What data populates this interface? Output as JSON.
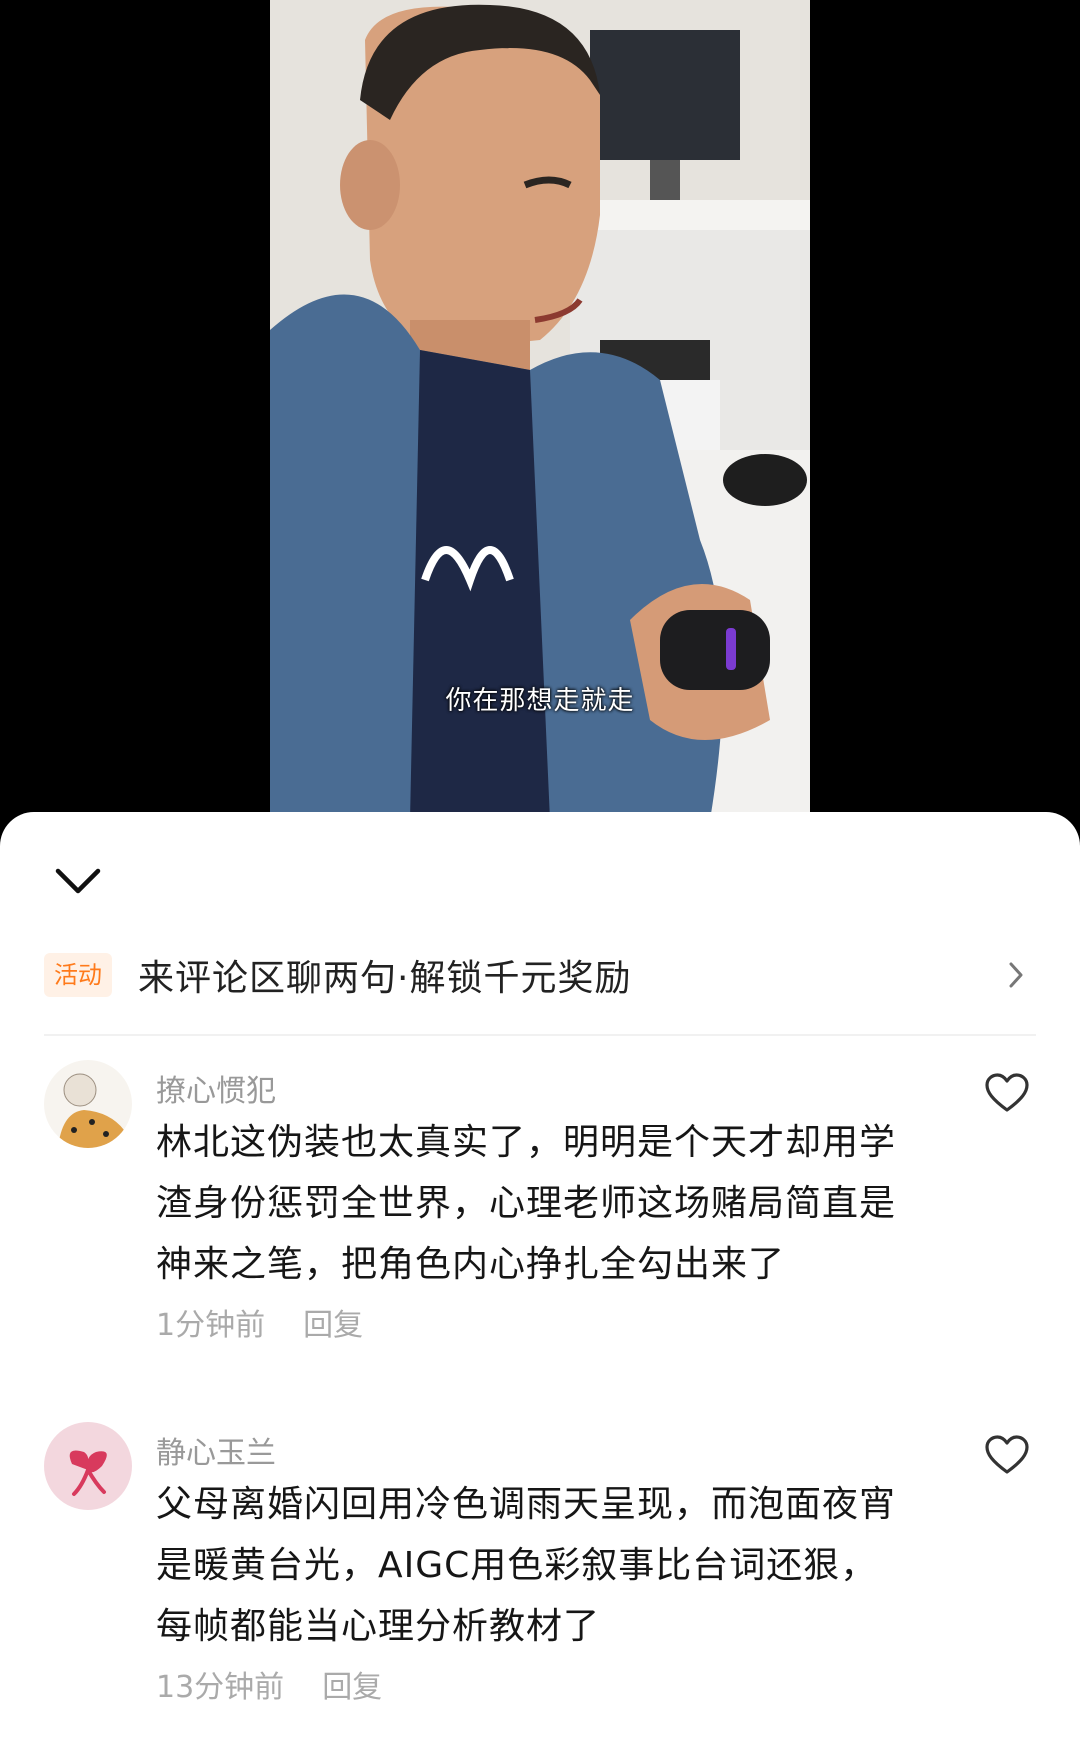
{
  "video": {
    "subtitle": "你在那想走就走"
  },
  "sheet": {
    "collapse_icon": "chevron-down-icon",
    "activity": {
      "badge": "活动",
      "text": "来评论区聊两句·解锁千元奖励",
      "icon": "chevron-right-icon"
    },
    "comments": [
      {
        "username": "撩心惯犯",
        "text": "林北这伪装也太真实了，明明是个天才却用学渣身份惩罚全世界，心理老师这场赌局简直是神来之笔，把角色内心挣扎全勾出来了",
        "time": "1分钟前",
        "reply": "回复",
        "like_icon": "heart-icon"
      },
      {
        "username": "静心玉兰",
        "text": "父母离婚闪回用冷色调雨天呈现，而泡面夜宵是暖黄台光，AIGC用色彩叙事比台词还狠，每帧都能当心理分析教材了",
        "time": "13分钟前",
        "reply": "回复",
        "like_icon": "heart-icon"
      }
    ]
  },
  "colors": {
    "accent": "#ff7a1a",
    "badge_bg": "#fff1e6",
    "muted_text": "#999999"
  }
}
